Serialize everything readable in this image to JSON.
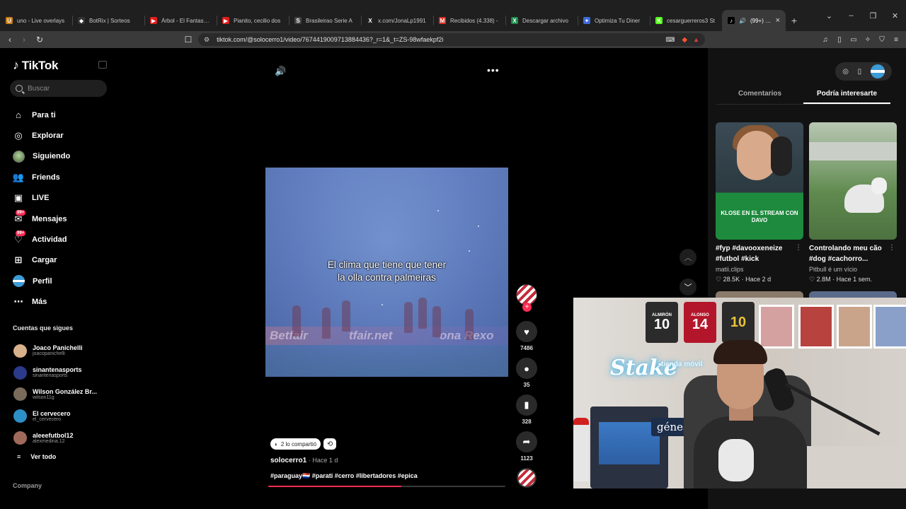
{
  "browser": {
    "tabs": [
      {
        "title": "uno - Live overlays",
        "fav": "U",
        "color": "#c77d17"
      },
      {
        "title": "BotRix | Sorteos",
        "fav": "◆",
        "color": "#333333"
      },
      {
        "title": "Árbol - El Fantasma",
        "fav": "▶",
        "color": "#e01d1d"
      },
      {
        "title": "Pianito, cecilio dos",
        "fav": "▶",
        "color": "#e01d1d"
      },
      {
        "title": "Brasileirao Serie A",
        "fav": "S",
        "color": "#444444"
      },
      {
        "title": "x.com/JonaLp1991",
        "fav": "X",
        "color": "#222222"
      },
      {
        "title": "Recibidos (4.338) -",
        "fav": "M",
        "color": "#d93025"
      },
      {
        "title": "Descargar archivo",
        "fav": "X",
        "color": "#1f8a4c"
      },
      {
        "title": "Optimiza Tu Diner",
        "fav": "✦",
        "color": "#3c6ad8"
      },
      {
        "title": "cesarguerreros3 St",
        "fav": "K",
        "color": "#53fc18"
      }
    ],
    "active_tab": {
      "title": "(99+) #para",
      "fav": "♪"
    },
    "new_tab": "+",
    "url": "tiktok.com/@solocerro1/video/7674419009713884436?_r=1&_t=ZS-98wfaekpf2i"
  },
  "sidebar": {
    "logo": "TikTok",
    "search_placeholder": "Buscar",
    "menu": [
      {
        "label": "Para ti",
        "icon": "⌂",
        "name": "home-icon"
      },
      {
        "label": "Explorar",
        "icon": "◎",
        "name": "compass-icon"
      },
      {
        "label": "Siguiendo",
        "icon": "",
        "name": "following-avatar-icon"
      },
      {
        "label": "Friends",
        "icon": "👥",
        "name": "friends-icon"
      },
      {
        "label": "LIVE",
        "icon": "▣",
        "name": "live-icon"
      },
      {
        "label": "Mensajes",
        "icon": "✉",
        "name": "messages-icon",
        "badge": "99+"
      },
      {
        "label": "Actividad",
        "icon": "♡",
        "name": "activity-icon",
        "badge": "99+"
      },
      {
        "label": "Cargar",
        "icon": "⊞",
        "name": "upload-icon"
      },
      {
        "label": "Perfil",
        "icon": "",
        "name": "profile-avatar-icon"
      },
      {
        "label": "Más",
        "icon": "⋯",
        "name": "more-icon"
      }
    ],
    "following_label": "Cuentas que sigues",
    "following": [
      {
        "name": "Joaco Panichelli",
        "handle": "joacopanichelli",
        "color": "#d9b08c"
      },
      {
        "name": "sinantenasports",
        "handle": "sinantenasports",
        "color": "#2b3a8a"
      },
      {
        "name": "Wilson González Br...",
        "handle": "wilson11g",
        "color": "#7a6b5a"
      },
      {
        "name": "El cervecero",
        "handle": "el_cervecero",
        "color": "#2d8fc7"
      },
      {
        "name": "aleeefutbol12",
        "handle": "alexmedina.12",
        "color": "#a06a5a"
      }
    ],
    "see_all": "Ver todo",
    "company": "Company"
  },
  "video": {
    "caption_line1": "El clima que tiene que tener",
    "caption_line2": "la olla contra palmeiras",
    "ad_text1": "Betfair",
    "ad_text2": "tfair.net",
    "ad_text3": "ona Rexo"
  },
  "actions": {
    "likes": "7486",
    "comments": "35",
    "saves": "328",
    "shares": "1123"
  },
  "post": {
    "shared_label": "2 lo compartió",
    "author": "solocerro1",
    "time": "· Hace 1 d",
    "hashtags": "#paraguay🇵🇾 #parati #cerro #libertadores #epica",
    "progress_pct": 56
  },
  "right_panel": {
    "tabs": [
      "Comentarios",
      "Podría interesarte"
    ],
    "cards": [
      {
        "title": "#fyp #davooxeneize #futbol #kick",
        "user": "matii.clips",
        "stats": "♡ 28.5K · Hace 2 d",
        "overlay": "KLOSE EN EL STREAM CON DAVO"
      },
      {
        "title": "Controlando meu cão #dog #cachorro...",
        "user": "Pitbull é um vício",
        "stats": "♡ 2.8M · Hace 1 sem."
      }
    ]
  },
  "webcam": {
    "stake": "Stake",
    "tienda": "tienda móvil",
    "genesis": "génesis",
    "jerseys": [
      {
        "name": "ALMIRÓN",
        "num": "10",
        "color": "#2b2b2b"
      },
      {
        "name": "ALONSO",
        "num": "14",
        "color": "#b3162a"
      },
      {
        "name": "",
        "num": "10",
        "color": "#2a2a2a"
      }
    ]
  }
}
